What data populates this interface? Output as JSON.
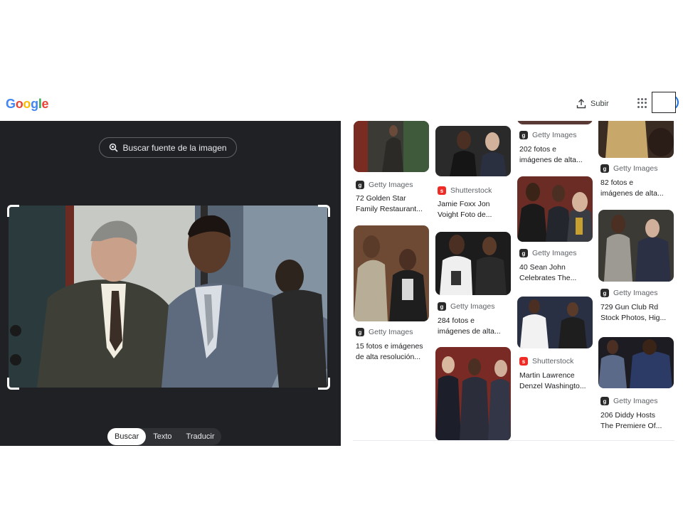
{
  "header": {
    "logo_letters": [
      {
        "ch": "G",
        "color": "#4285F4"
      },
      {
        "ch": "o",
        "color": "#EA4335"
      },
      {
        "ch": "o",
        "color": "#FBBC05"
      },
      {
        "ch": "g",
        "color": "#4285F4"
      },
      {
        "ch": "l",
        "color": "#34A853"
      },
      {
        "ch": "e",
        "color": "#EA4335"
      }
    ],
    "upload_label": "Subir",
    "upload_icon": "upload-icon",
    "apps_icon": "apps-grid-icon"
  },
  "lens": {
    "source_button_label": "Buscar fuente de la imagen",
    "source_button_icon": "lens-search-icon",
    "modes": [
      {
        "label": "Buscar",
        "active": true
      },
      {
        "label": "Texto",
        "active": false
      },
      {
        "label": "Traducir",
        "active": false
      }
    ]
  },
  "results": [
    {
      "source": "Getty Images",
      "favicon": "getty",
      "title_lines": [
        "72 Golden Star",
        "Family Restaurant..."
      ]
    },
    {
      "source": "Getty Images",
      "favicon": "getty",
      "title_lines": [
        "15 fotos e imágenes",
        "de alta resolución..."
      ]
    },
    {
      "source": "Shutterstock",
      "favicon": "shutterstock",
      "title_lines": [
        "Jamie Foxx Jon",
        "Voight Foto de..."
      ]
    },
    {
      "source": "Getty Images",
      "favicon": "getty",
      "title_lines": [
        "284 fotos e",
        "imágenes de alta..."
      ]
    },
    {
      "source": "Getty Images",
      "favicon": "getty",
      "title_lines": [
        "202 fotos e",
        "imágenes de alta..."
      ]
    },
    {
      "source": "Getty Images",
      "favicon": "getty",
      "title_lines": [
        "40 Sean John",
        "Celebrates The..."
      ]
    },
    {
      "source": "Shutterstock",
      "favicon": "shutterstock",
      "title_lines": [
        "Martin Lawrence",
        "Denzel Washingto..."
      ]
    },
    {
      "source": "Getty Images",
      "favicon": "getty",
      "title_lines": [
        "82 fotos e",
        "imágenes de alta..."
      ]
    },
    {
      "source": "Getty Images",
      "favicon": "getty",
      "title_lines": [
        "729 Gun Club Rd",
        "Stock Photos, Hig..."
      ]
    },
    {
      "source": "Getty Images",
      "favicon": "getty",
      "title_lines": [
        "206 Diddy Hosts",
        "The Premiere Of..."
      ]
    }
  ],
  "colors": {
    "accent_blue": "#1a73e8",
    "panel_dark": "#202124",
    "shutterstock_red": "#ee2b24"
  }
}
